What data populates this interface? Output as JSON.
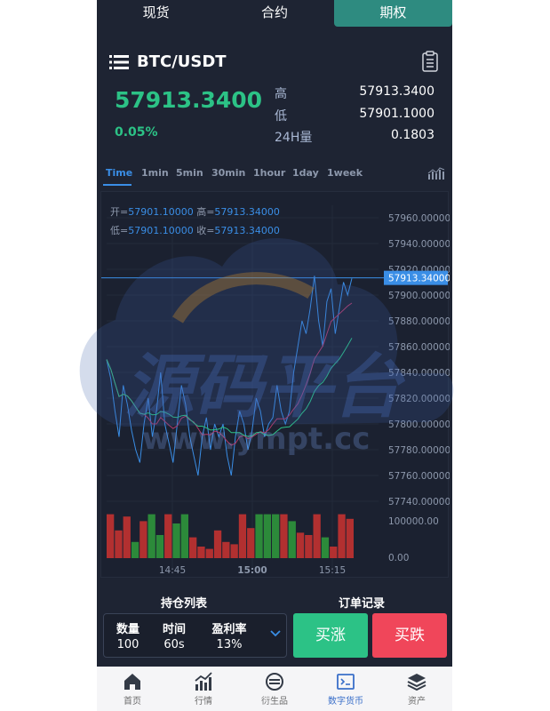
{
  "tabs": [
    {
      "label": "现货",
      "active": false
    },
    {
      "label": "合约",
      "active": false
    },
    {
      "label": "期权",
      "active": true
    }
  ],
  "header": {
    "pair": "BTC/USDT",
    "menu_icon": "list-icon",
    "right_icon": "clipboard-icon"
  },
  "ticker": {
    "price": "57913.3400",
    "change": "0.05%",
    "stats": [
      {
        "label": "高",
        "value": "57913.3400"
      },
      {
        "label": "低",
        "value": "57901.1000"
      },
      {
        "label": "24H量",
        "value": "0.1803"
      }
    ]
  },
  "timeframes": [
    "Time",
    "1min",
    "5min",
    "30min",
    "1hour",
    "1day",
    "1week"
  ],
  "active_timeframe": "Time",
  "legend": {
    "open_label": "开=",
    "open": "57901.10000",
    "high_label": "高=",
    "high": "57913.34000",
    "low_label": "低=",
    "low": "57901.10000",
    "close_label": "收=",
    "close": "57913.34000"
  },
  "watermark": {
    "main": "源码平台",
    "sub": "www.ympt.cc"
  },
  "chart_data": {
    "type": "line",
    "price_axis": [
      "57960.00000",
      "57940.00000",
      "57920.00000",
      "57900.00000",
      "57880.00000",
      "57860.00000",
      "57840.00000",
      "57820.00000",
      "57800.00000",
      "57780.00000",
      "57760.00000",
      "57740.00000"
    ],
    "ylim": [
      57740,
      57960
    ],
    "current_price": "57913.34000",
    "current_value": 57913.34,
    "time_ticks": [
      {
        "label": "14:45",
        "x": 80
      },
      {
        "label": "15:00",
        "x": 170
      },
      {
        "label": "15:15",
        "x": 260
      }
    ],
    "volume_axis": [
      "100000.00",
      "0.00"
    ],
    "series": [
      {
        "values": [
          57850,
          57835,
          57810,
          57790,
          57830,
          57815,
          57795,
          57780,
          57770,
          57800,
          57820,
          57790,
          57810,
          57840,
          57800,
          57785,
          57770,
          57800,
          57830,
          57815,
          57790,
          57775,
          57760,
          57790,
          57805,
          57780,
          57800,
          57790,
          57800,
          57775,
          57760,
          57790,
          57810,
          57800,
          57780,
          57795,
          57820,
          57810,
          57790,
          57800,
          57805,
          57830,
          57810,
          57800,
          57810,
          57840,
          57860,
          57880,
          57870,
          57890,
          57915,
          57880,
          57860,
          57895,
          57905,
          57870,
          57890,
          57910,
          57900,
          57913
        ]
      }
    ],
    "volumes": [
      {
        "v": 0.95,
        "up": false
      },
      {
        "v": 0.6,
        "up": false
      },
      {
        "v": 0.9,
        "up": false
      },
      {
        "v": 0.35,
        "up": true
      },
      {
        "v": 0.8,
        "up": false
      },
      {
        "v": 0.95,
        "up": true
      },
      {
        "v": 0.5,
        "up": true
      },
      {
        "v": 0.95,
        "up": false
      },
      {
        "v": 0.75,
        "up": true
      },
      {
        "v": 0.95,
        "up": true
      },
      {
        "v": 0.45,
        "up": false
      },
      {
        "v": 0.25,
        "up": false
      },
      {
        "v": 0.2,
        "up": false
      },
      {
        "v": 0.6,
        "up": false
      },
      {
        "v": 0.35,
        "up": false
      },
      {
        "v": 0.3,
        "up": false
      },
      {
        "v": 0.95,
        "up": false
      },
      {
        "v": 0.65,
        "up": false
      },
      {
        "v": 0.95,
        "up": true
      },
      {
        "v": 0.95,
        "up": true
      },
      {
        "v": 0.95,
        "up": true
      },
      {
        "v": 0.95,
        "up": false
      },
      {
        "v": 0.8,
        "up": true
      },
      {
        "v": 0.55,
        "up": false
      },
      {
        "v": 0.5,
        "up": false
      },
      {
        "v": 0.95,
        "up": false
      },
      {
        "v": 0.45,
        "up": true
      },
      {
        "v": 0.25,
        "up": false
      },
      {
        "v": 0.95,
        "up": false
      },
      {
        "v": 0.85,
        "up": false
      }
    ],
    "colors": {
      "line": "#3a8ee6",
      "ma1": "#b23a6a",
      "ma2": "#2cc286",
      "up": "#2c8a3a",
      "down": "#b23030",
      "axis_text": "#8d98ac",
      "price_tag": "#3a8ee6"
    }
  },
  "sections": [
    "持仓列表",
    "订单记录"
  ],
  "order": {
    "qty_label": "数量",
    "qty": "100",
    "time_label": "时间",
    "time": "60s",
    "rate_label": "盈利率",
    "rate": "13%"
  },
  "buttons": {
    "buy": "买涨",
    "sell": "买跌"
  },
  "bottom_nav": [
    {
      "label": "首页",
      "icon": "home-icon",
      "active": false
    },
    {
      "label": "行情",
      "icon": "chart-icon",
      "active": false
    },
    {
      "label": "衍生品",
      "icon": "derivative-icon",
      "active": false
    },
    {
      "label": "数字货币",
      "icon": "currency-icon",
      "active": true
    },
    {
      "label": "资产",
      "icon": "layers-icon",
      "active": false
    }
  ]
}
